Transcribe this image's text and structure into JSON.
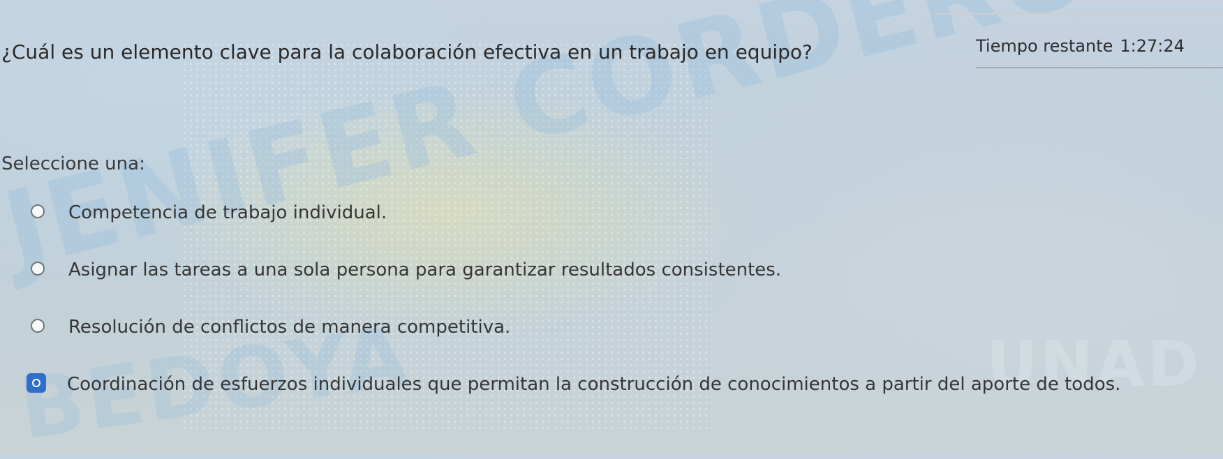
{
  "question": {
    "text": "¿Cuál es un elemento clave para la colaboración efectiva en un trabajo en equipo?"
  },
  "timer": {
    "label": "Tiempo restante",
    "value": "1:27:24"
  },
  "prompt": "Seleccione una:",
  "options": [
    {
      "label": "Competencia de trabajo individual.",
      "selected": false
    },
    {
      "label": "Asignar las tareas a una sola persona para garantizar resultados consistentes.",
      "selected": false
    },
    {
      "label": "Resolución de conflictos de manera competitiva.",
      "selected": false
    },
    {
      "label": "Coordinación de esfuerzos individuales que permitan la construcción de conocimientos a partir del aporte de todos.",
      "selected": true
    }
  ],
  "watermark": {
    "text_1": "JENIFER CORDERO",
    "text_2": "BEDOYA",
    "brand": "UNAD"
  },
  "colors": {
    "accent": "#2f6fcc",
    "text": "#2b2b2b"
  }
}
